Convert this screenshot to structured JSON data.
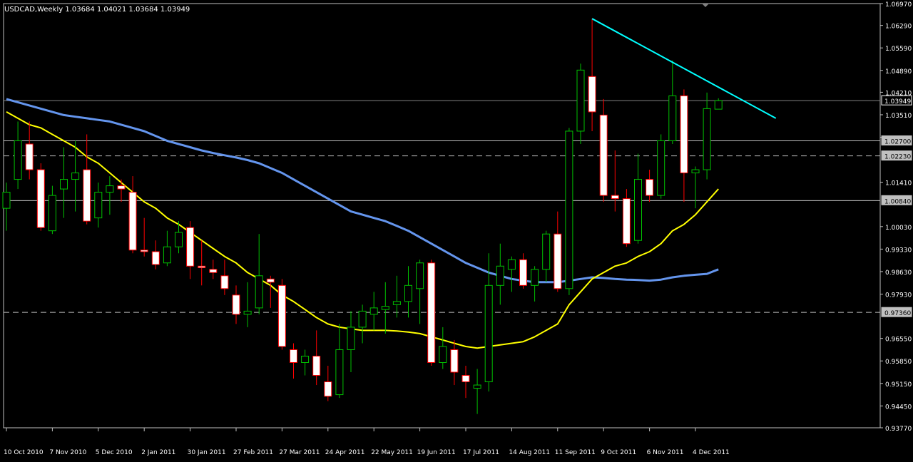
{
  "header": {
    "symbol_line": "USDCAD,Weekly  1.03684 1.04021 1.03684 1.03949"
  },
  "colors": {
    "background": "#000000",
    "frame": "#c0c0c0",
    "text": "#ffffff",
    "bull_candle": "#00c000",
    "bear_candle_body": "#ffffff",
    "bear_candle_wick": "#ff0000",
    "ma_fast": "#ffff00",
    "ma_slow": "#6495ed",
    "trendline": "#00ffff",
    "level_line": "#c0c0c0",
    "price_label_bg": "#c0c0c0",
    "price_label_text": "#000000"
  },
  "chart_data": {
    "type": "candlestick",
    "symbol": "USDCAD",
    "timeframe": "Weekly",
    "ylim": [
      0.9377,
      1.0697
    ],
    "y_ticks": [
      "1.06970",
      "1.06290",
      "1.05590",
      "1.04890",
      "1.04210",
      "1.03510",
      "1.02810",
      "1.01410",
      "1.00030",
      "0.99330",
      "0.98630",
      "0.97930",
      "0.96550",
      "0.95850",
      "0.95150",
      "0.94450",
      "0.93770"
    ],
    "x_tick_labels": [
      "10 Oct 2010",
      "7 Nov 2010",
      "5 Dec 2010",
      "2 Jan 2011",
      "30 Jan 2011",
      "27 Feb 2011",
      "27 Mar 2011",
      "24 Apr 2011",
      "22 May 2011",
      "19 Jun 2011",
      "17 Jul 2011",
      "14 Aug 2011",
      "11 Sep 2011",
      "9 Oct 2011",
      "6 Nov 2011",
      "4 Dec 2011"
    ],
    "x_tick_index": [
      0,
      4,
      8,
      12,
      16,
      20,
      24,
      28,
      32,
      36,
      40,
      44,
      48,
      52,
      56,
      60
    ],
    "price_labels": [
      "1.03949",
      "1.02700",
      "1.02230",
      "1.00840",
      "0.97360"
    ],
    "horizontal_lines": [
      {
        "price": 1.027,
        "style": "solid"
      },
      {
        "price": 1.0223,
        "style": "dashed"
      },
      {
        "price": 1.0084,
        "style": "solid"
      },
      {
        "price": 0.9736,
        "style": "dashed"
      }
    ],
    "current_price": 1.03949,
    "candles": [
      {
        "o": 1.006,
        "h": 1.014,
        "l": 0.999,
        "c": 1.011
      },
      {
        "o": 1.015,
        "h": 1.033,
        "l": 1.012,
        "c": 1.027
      },
      {
        "o": 1.026,
        "h": 1.033,
        "l": 1.015,
        "c": 1.018
      },
      {
        "o": 1.018,
        "h": 1.02,
        "l": 0.999,
        "c": 1.0
      },
      {
        "o": 0.999,
        "h": 1.013,
        "l": 0.998,
        "c": 1.01
      },
      {
        "o": 1.012,
        "h": 1.025,
        "l": 1.003,
        "c": 1.015
      },
      {
        "o": 1.015,
        "h": 1.027,
        "l": 1.005,
        "c": 1.017
      },
      {
        "o": 1.018,
        "h": 1.029,
        "l": 1.001,
        "c": 1.002
      },
      {
        "o": 1.003,
        "h": 1.014,
        "l": 1.0,
        "c": 1.011
      },
      {
        "o": 1.011,
        "h": 1.016,
        "l": 1.004,
        "c": 1.013
      },
      {
        "o": 1.013,
        "h": 1.015,
        "l": 1.008,
        "c": 1.012
      },
      {
        "o": 1.011,
        "h": 1.016,
        "l": 0.992,
        "c": 0.993
      },
      {
        "o": 0.993,
        "h": 1.003,
        "l": 0.991,
        "c": 0.9925
      },
      {
        "o": 0.9925,
        "h": 0.996,
        "l": 0.987,
        "c": 0.9885
      },
      {
        "o": 0.989,
        "h": 0.999,
        "l": 0.988,
        "c": 0.994
      },
      {
        "o": 0.994,
        "h": 1.002,
        "l": 0.992,
        "c": 0.9985
      },
      {
        "o": 1.0,
        "h": 1.002,
        "l": 0.984,
        "c": 0.988
      },
      {
        "o": 0.988,
        "h": 0.996,
        "l": 0.982,
        "c": 0.9875
      },
      {
        "o": 0.987,
        "h": 0.99,
        "l": 0.984,
        "c": 0.986
      },
      {
        "o": 0.985,
        "h": 0.99,
        "l": 0.979,
        "c": 0.981
      },
      {
        "o": 0.979,
        "h": 0.982,
        "l": 0.97,
        "c": 0.973
      },
      {
        "o": 0.973,
        "h": 0.983,
        "l": 0.969,
        "c": 0.974
      },
      {
        "o": 0.975,
        "h": 0.998,
        "l": 0.973,
        "c": 0.985
      },
      {
        "o": 0.984,
        "h": 0.985,
        "l": 0.975,
        "c": 0.983
      },
      {
        "o": 0.982,
        "h": 0.984,
        "l": 0.962,
        "c": 0.963
      },
      {
        "o": 0.962,
        "h": 0.964,
        "l": 0.953,
        "c": 0.958
      },
      {
        "o": 0.958,
        "h": 0.962,
        "l": 0.954,
        "c": 0.96
      },
      {
        "o": 0.96,
        "h": 0.968,
        "l": 0.951,
        "c": 0.954
      },
      {
        "o": 0.952,
        "h": 0.957,
        "l": 0.946,
        "c": 0.9475
      },
      {
        "o": 0.948,
        "h": 0.97,
        "l": 0.947,
        "c": 0.962
      },
      {
        "o": 0.962,
        "h": 0.974,
        "l": 0.955,
        "c": 0.969
      },
      {
        "o": 0.969,
        "h": 0.976,
        "l": 0.964,
        "c": 0.974
      },
      {
        "o": 0.973,
        "h": 0.98,
        "l": 0.968,
        "c": 0.975
      },
      {
        "o": 0.9745,
        "h": 0.983,
        "l": 0.967,
        "c": 0.9755
      },
      {
        "o": 0.976,
        "h": 0.985,
        "l": 0.972,
        "c": 0.977
      },
      {
        "o": 0.977,
        "h": 0.988,
        "l": 0.972,
        "c": 0.982
      },
      {
        "o": 0.981,
        "h": 0.99,
        "l": 0.97,
        "c": 0.989
      },
      {
        "o": 0.989,
        "h": 0.99,
        "l": 0.957,
        "c": 0.958
      },
      {
        "o": 0.958,
        "h": 0.969,
        "l": 0.956,
        "c": 0.963
      },
      {
        "o": 0.962,
        "h": 0.965,
        "l": 0.951,
        "c": 0.955
      },
      {
        "o": 0.954,
        "h": 0.957,
        "l": 0.947,
        "c": 0.952
      },
      {
        "o": 0.95,
        "h": 0.956,
        "l": 0.942,
        "c": 0.951
      },
      {
        "o": 0.952,
        "h": 0.992,
        "l": 0.949,
        "c": 0.982
      },
      {
        "o": 0.982,
        "h": 0.995,
        "l": 0.976,
        "c": 0.988
      },
      {
        "o": 0.987,
        "h": 0.991,
        "l": 0.98,
        "c": 0.99
      },
      {
        "o": 0.99,
        "h": 0.992,
        "l": 0.981,
        "c": 0.982
      },
      {
        "o": 0.982,
        "h": 0.988,
        "l": 0.977,
        "c": 0.987
      },
      {
        "o": 0.987,
        "h": 0.999,
        "l": 0.983,
        "c": 0.998
      },
      {
        "o": 0.998,
        "h": 1.005,
        "l": 0.98,
        "c": 0.981
      },
      {
        "o": 0.981,
        "h": 1.031,
        "l": 0.979,
        "c": 1.03
      },
      {
        "o": 1.03,
        "h": 1.051,
        "l": 1.026,
        "c": 1.049
      },
      {
        "o": 1.047,
        "h": 1.065,
        "l": 1.03,
        "c": 1.036
      },
      {
        "o": 1.035,
        "h": 1.04,
        "l": 1.008,
        "c": 1.01
      },
      {
        "o": 1.01,
        "h": 1.024,
        "l": 1.005,
        "c": 1.009
      },
      {
        "o": 1.009,
        "h": 1.012,
        "l": 0.994,
        "c": 0.995
      },
      {
        "o": 0.996,
        "h": 1.023,
        "l": 0.995,
        "c": 1.015
      },
      {
        "o": 1.015,
        "h": 1.018,
        "l": 1.008,
        "c": 1.01
      },
      {
        "o": 1.01,
        "h": 1.029,
        "l": 1.009,
        "c": 1.027
      },
      {
        "o": 1.027,
        "h": 1.052,
        "l": 1.026,
        "c": 1.041
      },
      {
        "o": 1.041,
        "h": 1.043,
        "l": 1.008,
        "c": 1.017
      },
      {
        "o": 1.017,
        "h": 1.019,
        "l": 1.006,
        "c": 1.018
      },
      {
        "o": 1.018,
        "h": 1.042,
        "l": 1.015,
        "c": 1.037
      },
      {
        "o": 1.03684,
        "h": 1.04021,
        "l": 1.03684,
        "c": 1.03949
      }
    ],
    "ma_fast": [
      1.036,
      1.034,
      1.032,
      1.031,
      1.029,
      1.027,
      1.025,
      1.022,
      1.02,
      1.017,
      1.014,
      1.011,
      1.008,
      1.006,
      1.003,
      1.001,
      0.9985,
      0.996,
      0.9935,
      0.991,
      0.989,
      0.986,
      0.984,
      0.982,
      0.979,
      0.977,
      0.9745,
      0.972,
      0.97,
      0.969,
      0.9685,
      0.968,
      0.968,
      0.968,
      0.9678,
      0.9675,
      0.967,
      0.966,
      0.965,
      0.964,
      0.963,
      0.9625,
      0.963,
      0.9635,
      0.964,
      0.9645,
      0.966,
      0.968,
      0.97,
      0.976,
      0.98,
      0.984,
      0.986,
      0.988,
      0.989,
      0.991,
      0.9925,
      0.995,
      0.999,
      1.001,
      1.004,
      1.008,
      1.012
    ],
    "ma_slow": [
      1.04,
      1.039,
      1.038,
      1.037,
      1.036,
      1.035,
      1.0345,
      1.034,
      1.0335,
      1.033,
      1.032,
      1.031,
      1.03,
      1.0285,
      1.027,
      1.026,
      1.025,
      1.024,
      1.0232,
      1.0225,
      1.0218,
      1.021,
      1.02,
      1.0185,
      1.017,
      1.015,
      1.013,
      1.011,
      1.009,
      1.007,
      1.005,
      1.004,
      1.003,
      1.002,
      1.0005,
      0.999,
      0.997,
      0.995,
      0.993,
      0.991,
      0.989,
      0.9875,
      0.986,
      0.985,
      0.984,
      0.9835,
      0.983,
      0.983,
      0.983,
      0.9835,
      0.984,
      0.9845,
      0.9843,
      0.984,
      0.9838,
      0.9837,
      0.9835,
      0.9838,
      0.9845,
      0.985,
      0.9853,
      0.9856,
      0.987
    ],
    "trendline": {
      "from": {
        "index": 51,
        "price": 1.065
      },
      "to": {
        "index": 67,
        "price": 1.034
      }
    }
  }
}
